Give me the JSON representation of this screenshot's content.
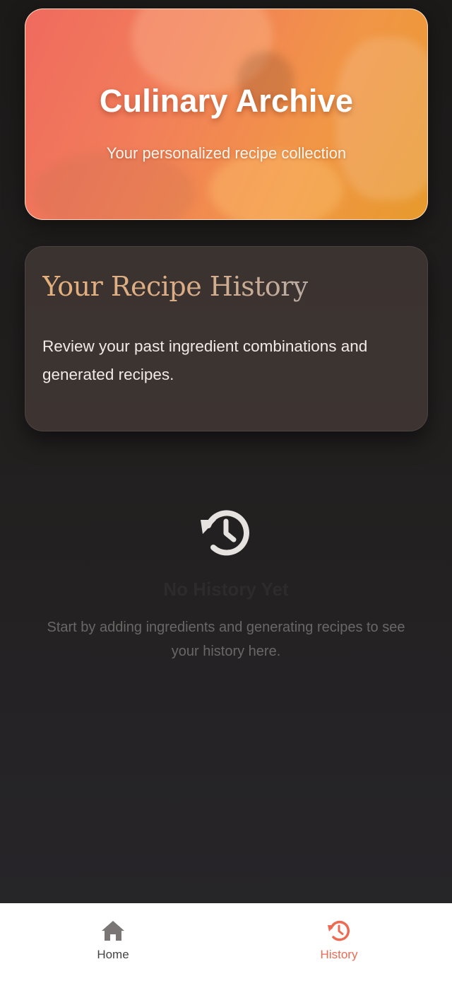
{
  "hero": {
    "title": "Culinary Archive",
    "subtitle": "Your personalized recipe collection"
  },
  "intro": {
    "title": "Your Recipe History",
    "text": "Review your past ingredient combinations and generated recipes."
  },
  "empty_state": {
    "icon": "history-icon",
    "title": "No History Yet",
    "text": "Start by adding ingredients and generating recipes to see your history here."
  },
  "bottom_nav": {
    "items": [
      {
        "label": "Home",
        "icon": "home-icon",
        "active": false
      },
      {
        "label": "History",
        "icon": "history-icon",
        "active": true
      }
    ]
  },
  "colors": {
    "accent": "#ee6a52",
    "hero_gradient_start": "#ef6a5e",
    "hero_gradient_end": "#e79a2c",
    "title_gold": "#e5b07c",
    "inactive_nav": "#444444"
  }
}
